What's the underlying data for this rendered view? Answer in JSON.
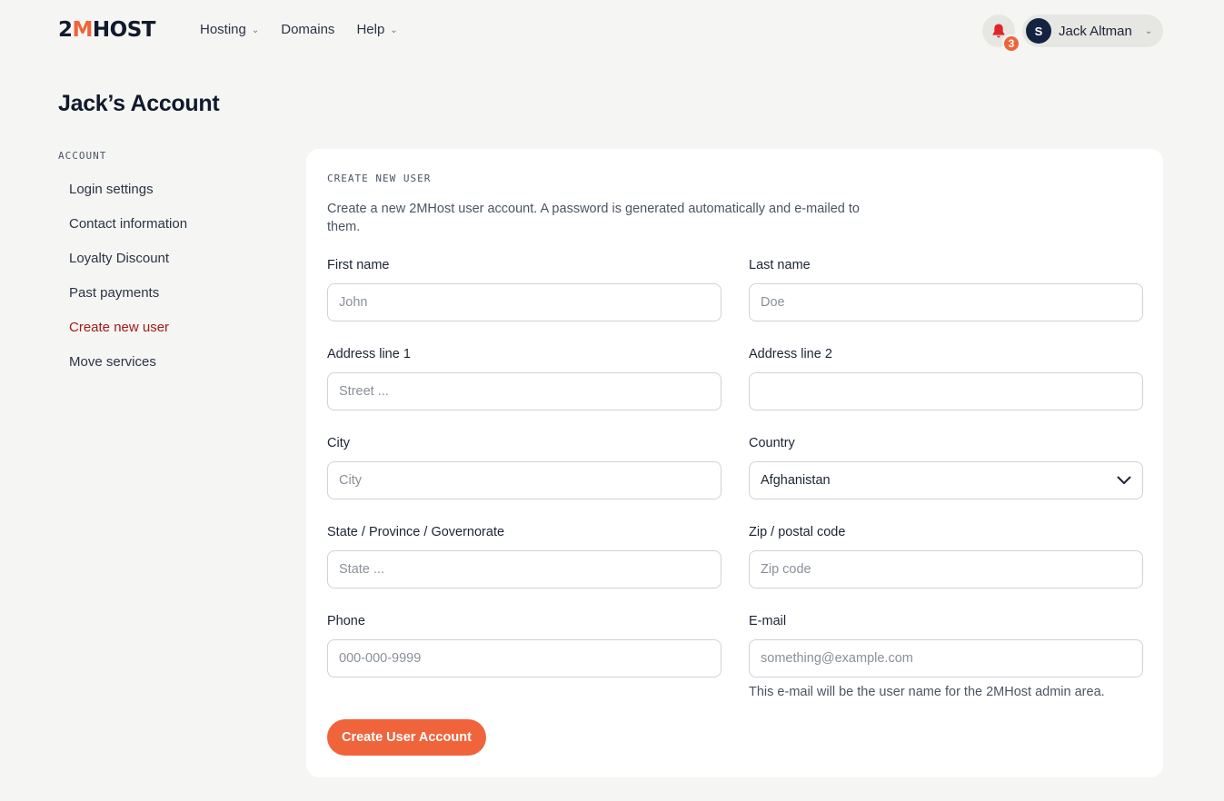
{
  "brand": {
    "logo_text_a": "2",
    "logo_text_m": "M",
    "logo_text_b": "HOST"
  },
  "nav": {
    "items": [
      {
        "label": "Hosting",
        "has_dropdown": true
      },
      {
        "label": "Domains",
        "has_dropdown": false
      },
      {
        "label": "Help",
        "has_dropdown": true
      }
    ]
  },
  "header": {
    "notification_count": "3",
    "user_initial": "S",
    "user_name": "Jack Altman"
  },
  "page": {
    "title": "Jack’s Account"
  },
  "sidebar": {
    "heading": "ACCOUNT",
    "items": [
      {
        "label": "Login settings",
        "active": false
      },
      {
        "label": "Contact information",
        "active": false
      },
      {
        "label": "Loyalty Discount",
        "active": false
      },
      {
        "label": "Past payments",
        "active": false
      },
      {
        "label": "Create new user",
        "active": true
      },
      {
        "label": "Move services",
        "active": false
      }
    ]
  },
  "form": {
    "heading": "CREATE NEW USER",
    "description": "Create a new 2MHost user account. A password is generated automatically and e-mailed to them.",
    "first_name": {
      "label": "First name",
      "placeholder": "John",
      "value": ""
    },
    "last_name": {
      "label": "Last name",
      "placeholder": "Doe",
      "value": ""
    },
    "address1": {
      "label": "Address line 1",
      "placeholder": "Street ...",
      "value": ""
    },
    "address2": {
      "label": "Address line 2",
      "placeholder": "",
      "value": ""
    },
    "city": {
      "label": "City",
      "placeholder": "City",
      "value": ""
    },
    "country": {
      "label": "Country",
      "selected": "Afghanistan"
    },
    "state": {
      "label": "State / Province / Governorate",
      "placeholder": "State ...",
      "value": ""
    },
    "zip": {
      "label": "Zip / postal code",
      "placeholder": "Zip code",
      "value": ""
    },
    "phone": {
      "label": "Phone",
      "placeholder": "000-000-9999",
      "value": ""
    },
    "email": {
      "label": "E-mail",
      "placeholder": "something@example.com",
      "value": "",
      "helper": "This e-mail will be the user name for the 2MHost admin area."
    },
    "submit_label": "Create User Account"
  },
  "colors": {
    "accent": "#f0643c",
    "active_link": "#a11a1a",
    "navy": "#142340",
    "page_bg": "#f5f5f3"
  }
}
